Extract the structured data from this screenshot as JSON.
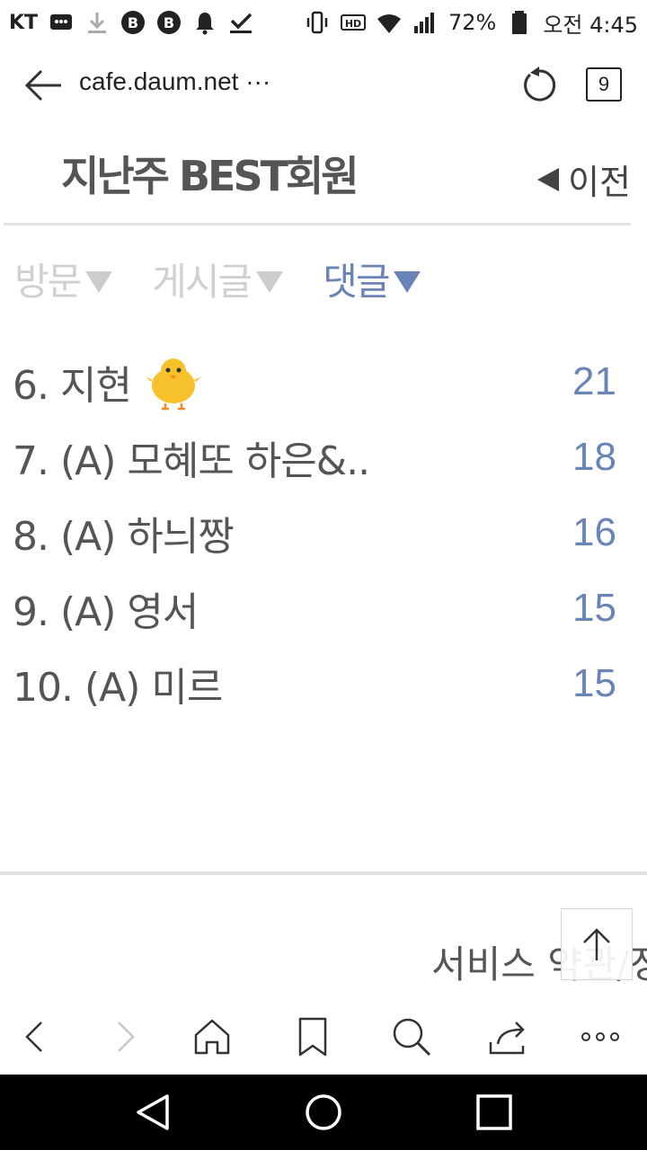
{
  "status_bar": {
    "carrier": "KT",
    "battery": "72%",
    "time": "오전 4:45",
    "icons": [
      "message-icon",
      "download-icon",
      "b-app-icon",
      "b-app-icon",
      "bell-icon",
      "check-icon",
      "vibrate-icon",
      "hd-icon",
      "wifi-icon",
      "signal-icon",
      "battery-icon"
    ]
  },
  "url_bar": {
    "url": "cafe.daum.net ···",
    "tab_count": "9"
  },
  "header": {
    "title": "지난주 BEST회원",
    "prev_label": "이전"
  },
  "tabs": [
    {
      "label": "방문",
      "active": false
    },
    {
      "label": "게시글",
      "active": false
    },
    {
      "label": "댓글",
      "active": true
    }
  ],
  "ranking": [
    {
      "name": "6. 지현",
      "count": "21",
      "emoji": "chick-icon"
    },
    {
      "name": "7. (A) 모혜또 하은&..",
      "count": "18"
    },
    {
      "name": "8. (A) 하늬짱",
      "count": "16"
    },
    {
      "name": "9. (A) 영서",
      "count": "15"
    },
    {
      "name": "10. (A) 미르",
      "count": "15"
    }
  ],
  "footer": {
    "link": "서비스 약관/정"
  },
  "colors": {
    "accent": "#6b84b8",
    "inactive": "#d0d0d0",
    "text": "#555555"
  }
}
